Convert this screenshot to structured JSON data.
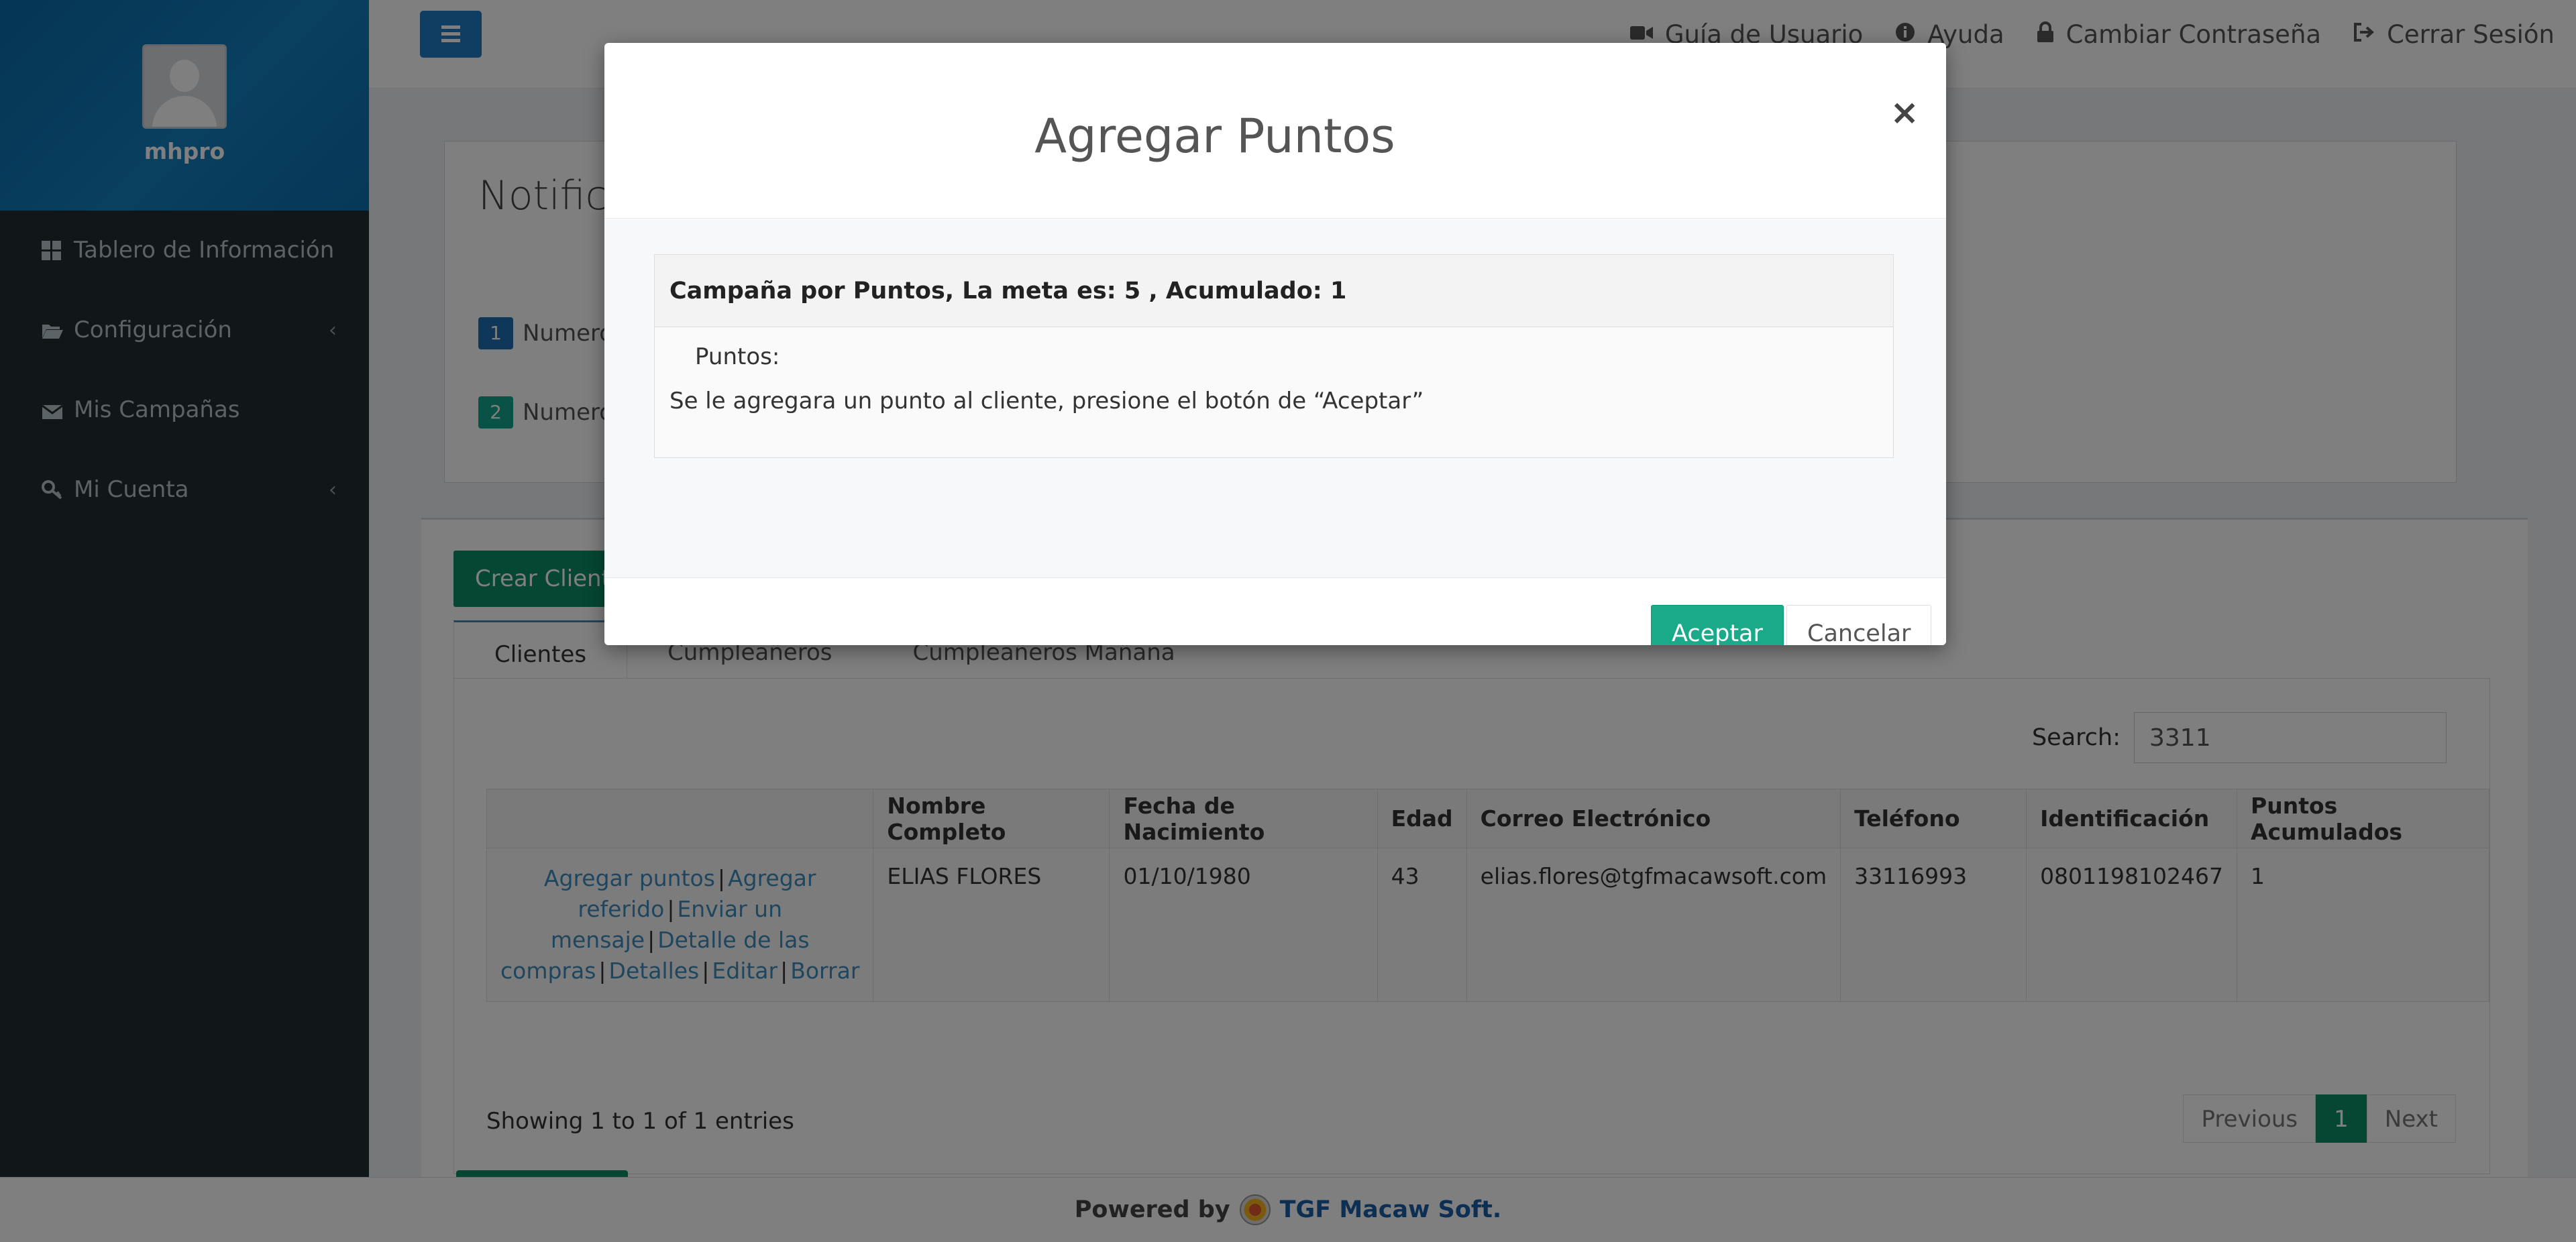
{
  "sidebar": {
    "user_name": "mhpro",
    "items": [
      {
        "label": "Tablero de Información",
        "icon": "dashboard-icon",
        "has_submenu": false
      },
      {
        "label": "Configuración",
        "icon": "folder-open-icon",
        "has_submenu": true
      },
      {
        "label": "Mis Campañas",
        "icon": "envelope-icon",
        "has_submenu": false
      },
      {
        "label": "Mi Cuenta",
        "icon": "key-icon",
        "has_submenu": true
      }
    ]
  },
  "navbar": {
    "links": [
      {
        "label": "Guía de Usuario",
        "icon": "video-camera-icon"
      },
      {
        "label": "Ayuda",
        "icon": "info-circle-icon"
      },
      {
        "label": "Cambiar Contraseña",
        "icon": "lock-icon"
      },
      {
        "label": "Cerrar Sesión",
        "icon": "sign-out-icon"
      }
    ]
  },
  "notifications": {
    "title": "Notifica",
    "rows": [
      {
        "badge": "1",
        "text": "Numero",
        "color": "#1f6fb2"
      },
      {
        "badge": "2",
        "text": "Numero",
        "color": "#17a58c"
      }
    ]
  },
  "main": {
    "create_button": "Crear Cliente",
    "tabs": [
      {
        "label": "Clientes",
        "active": true
      },
      {
        "label": "Cumpleañeros",
        "active": false
      },
      {
        "label": "Cumpleañeros Mañana",
        "active": false
      }
    ],
    "search_label": "Search:",
    "search_value": "3311",
    "table": {
      "headers": [
        "",
        "Nombre Completo",
        "Fecha de Nacimiento",
        "Edad",
        "Correo Electrónico",
        "Teléfono",
        "Identificación",
        "Puntos Acumulados"
      ],
      "rows": [
        {
          "actions": [
            "Agregar puntos",
            "Agregar referido",
            "Enviar un mensaje",
            "Detalle de las compras",
            "Detalles",
            "Editar",
            "Borrar"
          ],
          "nombre": "ELIAS FLORES",
          "fecha": "01/10/1980",
          "edad": "43",
          "correo": "elias.flores@tgfmacawsoft.com",
          "telefono": "33116993",
          "identificacion": "0801198102467",
          "puntos": "1"
        }
      ]
    },
    "info": "Showing 1 to 1 of 1 entries",
    "pager": {
      "previous": "Previous",
      "current": "1",
      "next": "Next"
    }
  },
  "footer": {
    "powered_by": "Powered by",
    "brand": "TGF Macaw Soft."
  },
  "modal": {
    "title": "Agregar Puntos",
    "close": "×",
    "panel_heading": "Campaña por Puntos, La meta es: 5 , Acumulado: 1",
    "label": "Puntos:",
    "message": "Se le agregara un punto al cliente, presione el botón de “Aceptar”",
    "accept": "Aceptar",
    "cancel": "Cancelar"
  },
  "colors": {
    "sidebar_bg": "#222d32",
    "user_panel": "#137fbf",
    "accent_green": "#1aaa8a",
    "link_blue": "#3c8dbc"
  }
}
